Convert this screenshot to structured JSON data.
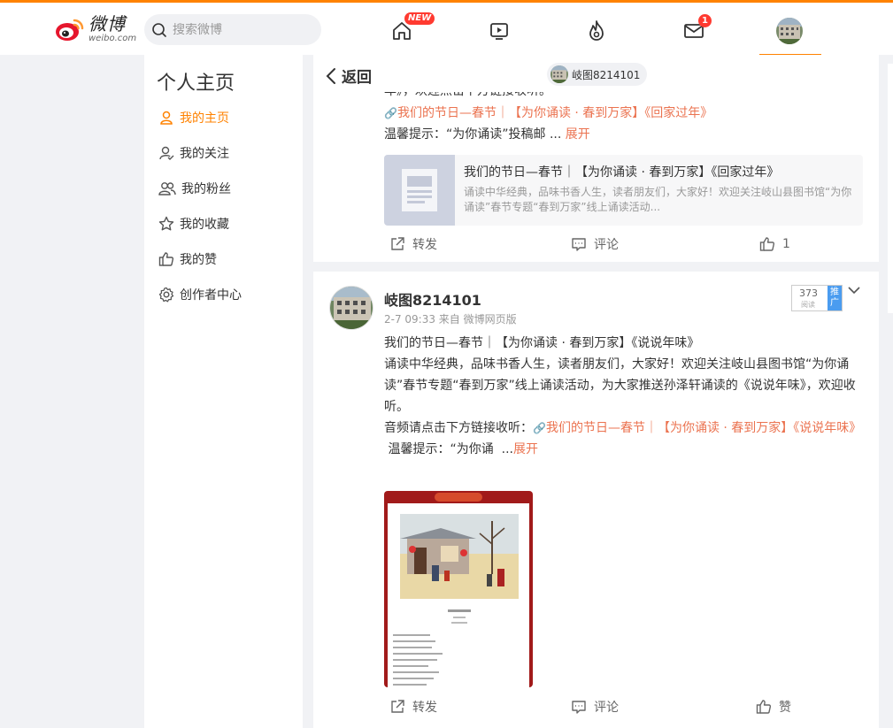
{
  "header": {
    "logo_cn": "微博",
    "logo_en": "weibo.com",
    "search_placeholder": "搜索微博",
    "home_badge": "NEW",
    "message_badge": "1"
  },
  "sidebar": {
    "title": "个人主页",
    "items": [
      {
        "label": "我的主页",
        "icon": "person-icon",
        "active": true
      },
      {
        "label": "我的关注",
        "icon": "follow-icon"
      },
      {
        "label": "我的粉丝",
        "icon": "fans-icon"
      },
      {
        "label": "我的收藏",
        "icon": "star-icon"
      },
      {
        "label": "我的赞",
        "icon": "thumb-up-icon"
      },
      {
        "label": "创作者中心",
        "icon": "gear-icon"
      }
    ]
  },
  "backbar": {
    "back_label": "返回",
    "user_chip": "岐图8214101"
  },
  "post1": {
    "cut_text": "年》，欢迎点击下方链接收听。",
    "link_text": "我们的节日—春节｜【为你诵读 · 春到万家】《回家过年》",
    "tip_text": "温馨提示：“为你诵读”投稿邮",
    "ellipsis": "...",
    "expand": "展开",
    "article_title": "我们的节日—春节｜【为你诵读 · 春到万家】《回家过年》",
    "article_desc": "诵读中华经典，品味书香人生，读者朋友们，大家好！欢迎关注岐山县图书馆“为你诵读”春节专题“春到万家”线上诵读活动...",
    "repost": "转发",
    "comment": "评论",
    "like": "1"
  },
  "post2": {
    "username": "岐图8214101",
    "meta": "2-7 09:33  来自 微博网页版",
    "read_count": "373",
    "read_label": "阅读",
    "promote": "推广",
    "text_line1": "我们的节日—春节｜【为你诵读 · 春到万家】《说说年味》",
    "text_body": "诵读中华经典，品味书香人生，读者朋友们，大家好！欢迎关注岐山县图书馆“为你诵读”春节专题“春到万家”线上诵读活动，为大家推送孙泽轩诵读的《说说年味》，欢迎收听。",
    "audio_prefix": "音频请点击下方链接收听：",
    "audio_link": "我们的节日—春节｜【为你诵读 · 春到万家】《说说年味》",
    "tip_text": "温馨提示：“为你诵",
    "ellipsis": "...",
    "expand": "展开",
    "repost": "转发",
    "comment": "评论",
    "like": "赞"
  }
}
